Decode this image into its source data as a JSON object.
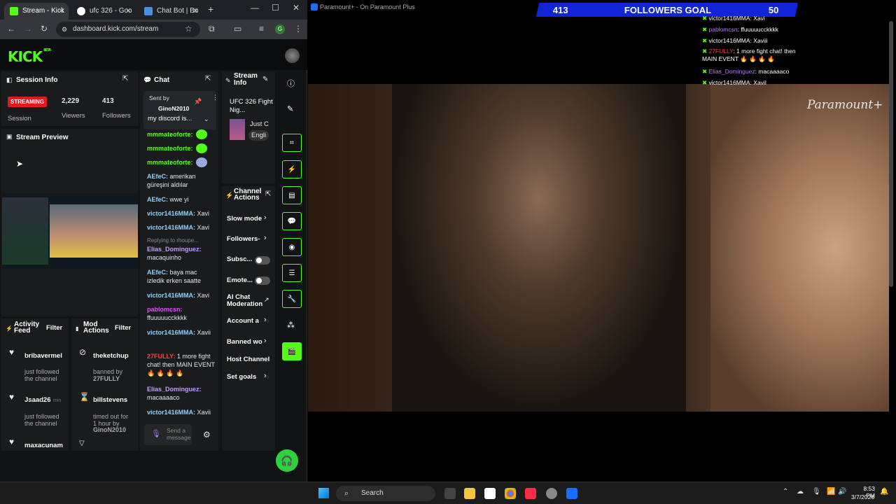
{
  "browser": {
    "tabs": [
      {
        "label": "Stream - Kick"
      },
      {
        "label": "ufc 326 - Goo"
      },
      {
        "label": "Chat Bot | Bo"
      }
    ],
    "url": "dashboard.kick.com/stream",
    "profile_initial": "G"
  },
  "kick": {
    "logo": "KICK",
    "logo_badge": "BETA",
    "session": {
      "title": "Session Info",
      "status": "STREAMING",
      "status_label": "Session",
      "viewers_value": "2,229",
      "viewers_label": "Viewers",
      "followers_value": "413",
      "followers_label": "Followers"
    },
    "preview": {
      "title": "Stream Preview"
    },
    "chat": {
      "title": "Chat",
      "pinned_label": "Sent by",
      "pinned_user": "GinoN2010",
      "pinned_text": "my discord is...",
      "input_placeholder": "Send a message",
      "messages": [
        {
          "user": "mmmateoforte:",
          "text": ""
        },
        {
          "user": "mmmateoforte:",
          "text": ""
        },
        {
          "user": "mmmateoforte:",
          "text": ""
        },
        {
          "user": "AEfeC:",
          "text": "amerikan güreşini aldılar"
        },
        {
          "user": "AEfeC:",
          "text": "wwe yi"
        },
        {
          "user": "victor1416MMA:",
          "text": "Xavi"
        },
        {
          "user": "victor1416MMA:",
          "text": "Xavi"
        },
        {
          "reply": "Replying to rhoupe...",
          "user": "Elias_Dominguez:",
          "text": "macaquinho"
        },
        {
          "user": "AEfeC:",
          "text": "baya mac izledik erken saatte"
        },
        {
          "user": "victor1416MMA:",
          "text": "Xavi"
        },
        {
          "user": "pablomcsn:",
          "text": "ffuuuuucckkkk"
        },
        {
          "user": "victor1416MMA:",
          "text": "Xavii"
        },
        {
          "user": "27FULLY:",
          "text": "1 more fight chat! then MAIN EVENT 🔥 🔥 🔥 🔥"
        },
        {
          "user": "Elias_Dominguez:",
          "text": "macaaaaco"
        },
        {
          "user": "victor1416MMA:",
          "text": "Xavii"
        }
      ]
    },
    "stream_info": {
      "title": "Stream Info",
      "stream_title": "UFC 326 Fight Nig...",
      "category": "Just C",
      "language": "Engli"
    },
    "channel_actions": {
      "title": "Channel Actions",
      "items": [
        "Slow mode",
        "Followers-",
        "Subsc...",
        "Emote...",
        "AI Chat Moderation",
        "Account a",
        "Banned wo",
        "Host Channel",
        "Set goals"
      ]
    },
    "activity": {
      "title": "Activity Feed",
      "filter": "Filter",
      "items": [
        {
          "name": "bribavermel",
          "desc": "just followed the channel"
        },
        {
          "name": "Jsaad26",
          "suffix": "min",
          "desc": "just followed the channel"
        },
        {
          "name": "maxacunam",
          "desc": ""
        }
      ]
    },
    "mod": {
      "title": "Mod Actions",
      "filter": "Filter",
      "items": [
        {
          "name": "theketchup",
          "desc": "banned by",
          "by": "27FULLY"
        },
        {
          "name": "billstevens",
          "desc": "timed out for 1 hour by",
          "by": "GinoN2010"
        }
      ]
    }
  },
  "video": {
    "window_title": "Paramount+ - On Paramount Plus",
    "watermark": "Paramount+",
    "goal": {
      "current": "413",
      "label": "FOLLOWERS GOAL",
      "target": "50"
    },
    "overlay_chat": [
      {
        "user": "victor1416MMA",
        "text": ": Xavi"
      },
      {
        "user": "pablomcsn",
        "text": ": ffuuuuucckkkk"
      },
      {
        "user": "victor1416MMA",
        "text": ": Xaviii"
      },
      {
        "user": "27FULLY",
        "text": ": 1 more fight chat! then MAIN EVENT 🔥 🔥 🔥 🔥"
      },
      {
        "user": "Elias_Dominguez",
        "text": ": macaaaaco"
      },
      {
        "user": "victor1416MMA",
        "text": ": Xavil"
      }
    ]
  },
  "taskbar": {
    "search": "Search",
    "time": "8:53 PM",
    "date": "3/7/2026"
  }
}
